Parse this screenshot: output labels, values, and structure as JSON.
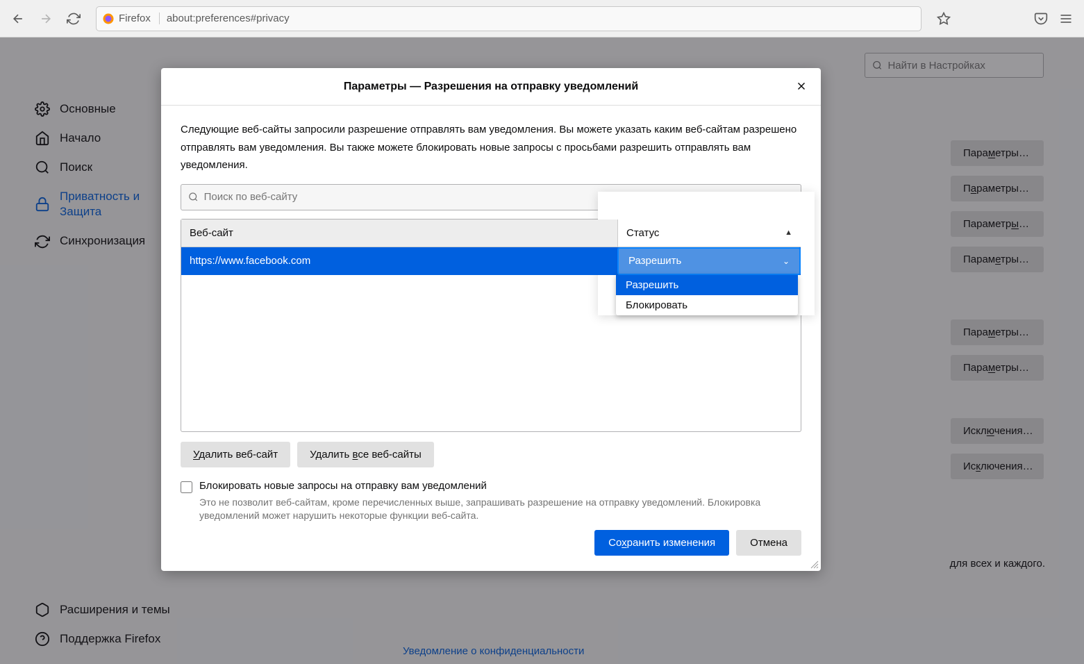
{
  "browser": {
    "ff_label": "Firefox",
    "url": "about:preferences#privacy"
  },
  "search": {
    "placeholder": "Найти в Настройках"
  },
  "sidebar": {
    "items": [
      {
        "label": "Основные"
      },
      {
        "label": "Начало"
      },
      {
        "label": "Поиск"
      },
      {
        "label": "Приватность и Защита"
      },
      {
        "label": "Синхронизация"
      }
    ],
    "bottom": [
      {
        "label": "Расширения и темы"
      },
      {
        "label": "Поддержка Firefox"
      }
    ]
  },
  "bg": {
    "btn1": "Параметры…",
    "btn2": "Параметры…",
    "btn3": "Параметры…",
    "btn4": "Параметры…",
    "btn5": "Параметры…",
    "btn6": "Параметры…",
    "btn7": "Исключения…",
    "btn8": "Исключения…",
    "text": "для всех и каждого.",
    "privacy_link": "Уведомление о конфиденциальности"
  },
  "dialog": {
    "title": "Параметры — Разрешения на отправку уведомлений",
    "description": "Следующие веб-сайты запросили разрешение отправлять вам уведомления. Вы можете указать каким веб-сайтам разрешено отправлять вам уведомления. Вы также можете блокировать новые запросы с просьбами разрешить отправлять вам уведомления.",
    "search_placeholder": "Поиск по веб-сайту",
    "th_site": "Веб-сайт",
    "th_status": "Статус",
    "row_site": "https://www.facebook.com",
    "row_status": "Разрешить",
    "dropdown": {
      "option_allow": "Разрешить",
      "option_block": "Блокировать"
    },
    "btn_remove": "Удалить веб-сайт",
    "btn_remove_all": "Удалить все веб-сайты",
    "block_label": "Блокировать новые запросы на отправку вам уведомлений",
    "block_desc": "Это не позволит веб-сайтам, кроме перечисленных выше, запрашивать разрешение на отправку уведомлений. Блокировка уведомлений может нарушить некоторые функции веб-сайта.",
    "btn_save": "Сохранить изменения",
    "btn_cancel": "Отмена"
  }
}
